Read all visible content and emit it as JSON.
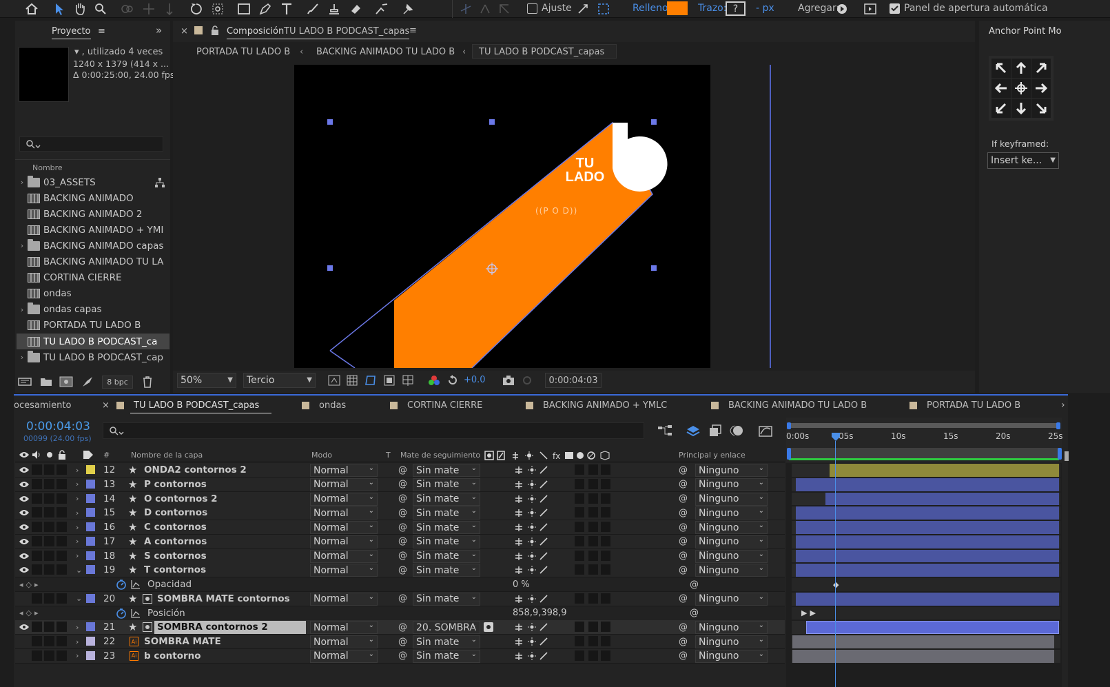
{
  "toolbar": {
    "ajuste_label": "Ajuste",
    "relleno_label": "Relleno:",
    "relleno_color": "#ff7f00",
    "trazo_label": "Trazo:",
    "trazo_value": "?",
    "px_label": "- px",
    "agregar_label": "Agregar:",
    "panel_label": "Panel de apertura automática"
  },
  "project": {
    "tab_label": "Proyecto",
    "usage": "▾ , utilizado 4 veces",
    "dims": "1240 x 1379  (414 x ...",
    "duration": "Δ 0:00:25:00, 24.00 fps",
    "column_name": "Nombre",
    "bpc": "8 bpc",
    "items": [
      {
        "label": "03_ASSETS",
        "type": "folder"
      },
      {
        "label": "BACKING ANIMADO",
        "type": "comp"
      },
      {
        "label": "BACKING ANIMADO 2",
        "type": "comp"
      },
      {
        "label": "BACKING ANIMADO + YMI",
        "type": "comp"
      },
      {
        "label": "BACKING ANIMADO capas",
        "type": "folder"
      },
      {
        "label": "BACKING ANIMADO TU LA",
        "type": "comp"
      },
      {
        "label": "CORTINA CIERRE",
        "type": "comp"
      },
      {
        "label": "ondas",
        "type": "comp"
      },
      {
        "label": "ondas capas",
        "type": "folder"
      },
      {
        "label": "PORTADA TU LADO B",
        "type": "comp"
      },
      {
        "label": "TU LADO B PODCAST_ca",
        "type": "comp"
      },
      {
        "label": "TU LADO B PODCAST_cap",
        "type": "folder"
      }
    ]
  },
  "composition": {
    "tab_prefix": "Composición",
    "tab_name": "TU LADO B PODCAST_capas",
    "breadcrumbs": [
      "PORTADA TU LADO B",
      "BACKING ANIMADO TU LADO B",
      "TU LADO B PODCAST_capas"
    ],
    "logo_line1": "TU",
    "logo_line2": "LADO",
    "podcast_text": "((P O D))",
    "zoom": "50%",
    "resolution": "Tercio",
    "exposure": "+0.0",
    "timecode": "0:00:04:03",
    "accent": "#ff7f00"
  },
  "anchor": {
    "title": "Anchor Point Mo",
    "if_keyframed": "If keyframed:",
    "insert_option": "Insert ke..."
  },
  "timeline": {
    "tab_left": "ocesamiento",
    "tabs": [
      {
        "label": "TU LADO B PODCAST_capas",
        "active": true
      },
      {
        "label": "ondas",
        "active": false
      },
      {
        "label": "CORTINA CIERRE",
        "active": false
      },
      {
        "label": "BACKING ANIMADO + YMLC",
        "active": false
      },
      {
        "label": "BACKING ANIMADO TU LADO B",
        "active": false
      },
      {
        "label": "PORTADA TU LADO B",
        "active": false
      }
    ],
    "timecode": "0:00:04:03",
    "frames": "00099 (24.00 fps)",
    "headers": {
      "num": "#",
      "name": "Nombre de la capa",
      "mode": "Modo",
      "t": "T",
      "mate": "Mate de seguimiento",
      "parent": "Principal y enlace"
    },
    "ruler": [
      "0:00s",
      "05s",
      "10s",
      "15s",
      "20s",
      "25s"
    ],
    "layers": [
      {
        "kind": "layer",
        "num": "12",
        "name": "ONDA2 contornos 2",
        "mode": "Normal",
        "mate": "Sin mate",
        "parent": "Ninguno",
        "color": "#e0cf4a",
        "bar": "#8f8a3a"
      },
      {
        "kind": "layer",
        "num": "13",
        "name": "P contornos",
        "mode": "Normal",
        "mate": "Sin mate",
        "parent": "Ninguno",
        "color": "#6a78d8",
        "bar": "#4a55a0"
      },
      {
        "kind": "layer",
        "num": "14",
        "name": "O contornos 2",
        "mode": "Normal",
        "mate": "Sin mate",
        "parent": "Ninguno",
        "color": "#6a78d8",
        "bar": "#4a55a0"
      },
      {
        "kind": "layer",
        "num": "15",
        "name": "D contornos",
        "mode": "Normal",
        "mate": "Sin mate",
        "parent": "Ninguno",
        "color": "#6a78d8",
        "bar": "#4a55a0"
      },
      {
        "kind": "layer",
        "num": "16",
        "name": "C contornos",
        "mode": "Normal",
        "mate": "Sin mate",
        "parent": "Ninguno",
        "color": "#6a78d8",
        "bar": "#4a55a0"
      },
      {
        "kind": "layer",
        "num": "17",
        "name": "A contornos",
        "mode": "Normal",
        "mate": "Sin mate",
        "parent": "Ninguno",
        "color": "#6a78d8",
        "bar": "#4a55a0"
      },
      {
        "kind": "layer",
        "num": "18",
        "name": "S contornos",
        "mode": "Normal",
        "mate": "Sin mate",
        "parent": "Ninguno",
        "color": "#6a78d8",
        "bar": "#4a55a0"
      },
      {
        "kind": "layer",
        "num": "19",
        "name": "T contornos",
        "mode": "Normal",
        "mate": "Sin mate",
        "parent": "Ninguno",
        "color": "#6a78d8",
        "bar": "#4a55a0"
      },
      {
        "kind": "prop",
        "name": "Opacidad",
        "value": "0 %"
      },
      {
        "kind": "layer",
        "num": "20",
        "name": "SOMBRA MATE contornos",
        "mode": "Normal",
        "mate": "Sin mate",
        "parent": "Ninguno",
        "color": "#6a78d8",
        "bar": "#4a55a0"
      },
      {
        "kind": "prop",
        "name": "Posición",
        "value": "858,9,398,9"
      },
      {
        "kind": "layer",
        "num": "21",
        "name": "SOMBRA contornos 2",
        "mode": "Normal",
        "mate": "20. SOMBRA",
        "parent": "Ninguno",
        "color": "#6a78d8",
        "bar": "#5b69d6",
        "selected": true
      },
      {
        "kind": "layer",
        "num": "22",
        "name": "SOMBRA MATE",
        "mode": "Normal",
        "mate": "Sin mate",
        "parent": "Ninguno",
        "color": "#b9b3dd",
        "bar": "#6a6a72",
        "ai": true
      },
      {
        "kind": "layer",
        "num": "23",
        "name": "b contorno",
        "mode": "Normal",
        "mate": "Sin mate",
        "parent": "Ninguno",
        "color": "#b9b3dd",
        "bar": "#6a6a72",
        "ai": true
      }
    ]
  }
}
